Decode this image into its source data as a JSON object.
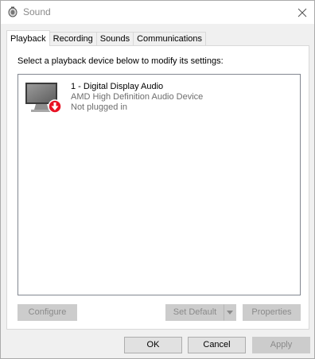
{
  "window": {
    "title": "Sound",
    "icon": "speaker-icon",
    "close_icon": "close-icon"
  },
  "tabs": [
    {
      "label": "Playback",
      "active": true
    },
    {
      "label": "Recording",
      "active": false
    },
    {
      "label": "Sounds",
      "active": false
    },
    {
      "label": "Communications",
      "active": false
    }
  ],
  "playback": {
    "instruction": "Select a playback device below to modify its settings:",
    "devices": [
      {
        "name": "1 - Digital Display Audio",
        "driver": "AMD High Definition Audio Device",
        "status": "Not plugged in",
        "icon": "monitor-icon",
        "status_icon": "down-arrow-icon",
        "status_color": "#e81123"
      }
    ],
    "buttons": {
      "configure": "Configure",
      "set_default": "Set Default",
      "properties": "Properties"
    }
  },
  "footer": {
    "ok": "OK",
    "cancel": "Cancel",
    "apply": "Apply"
  }
}
